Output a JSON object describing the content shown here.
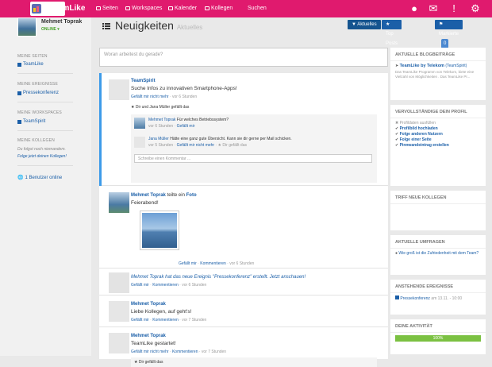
{
  "app": {
    "name": "TeamLike"
  },
  "nav": {
    "items": [
      {
        "label": "Seiten",
        "icon": "pages-icon"
      },
      {
        "label": "Workspaces",
        "icon": "workspaces-icon"
      },
      {
        "label": "Kalender",
        "icon": "calendar-icon"
      },
      {
        "label": "Kollegen",
        "icon": "colleagues-icon"
      }
    ],
    "search_placeholder": "Suchen"
  },
  "colors": {
    "brand": "#e01a6e",
    "accent": "#1b5fa8",
    "success": "#7bc142"
  },
  "user": {
    "name": "Mehmet Toprak",
    "status": "ONLINE"
  },
  "sidebar": {
    "pages_title": "MEINE SEITEN",
    "pages": [
      "TeamLike"
    ],
    "events_title": "MEINE EREIGNISSE",
    "events": [
      "Pressekonferenz"
    ],
    "workspaces_title": "MEINE WORKSPACES",
    "workspaces": [
      "TeamSpirit"
    ],
    "colleagues_title": "MEINE KOLLEGEN",
    "colleagues_empty": "Du folgst noch niemandem.",
    "colleagues_link": "Folge jetzt deinen Kollegen!",
    "online": "1 Benutzer online"
  },
  "page": {
    "title": "Neuigkeiten",
    "subtitle": "Aktuelles",
    "btn_latest": "Aktuelles",
    "btn_top": "Top Posts",
    "btn_marked": "Markierte",
    "marked_count": "0"
  },
  "composer": {
    "placeholder": "Woran arbeitest du gerade?"
  },
  "posts": [
    {
      "author": "TeamSpirit",
      "text": "Suche Infos zu innovativen Smartphone-Apps!",
      "meta_like": "Gefällt mir nicht mehr",
      "meta_time": "· vor 6 Stunden",
      "likes": "Dir und Jana Müller gefällt das",
      "comments": [
        {
          "author": "Mehmet Toprak",
          "text": "Für welches Betriebssystem?",
          "time": "vor 6 Stunden ·",
          "like": "Gefällt mir"
        },
        {
          "author": "Jana Müller",
          "text": "Hätte eine ganz gute Übersicht. Kann sie dir gerne per Mail schicken.",
          "time": "vor 5 Stunden ·",
          "like": "Gefällt mir nicht mehr",
          "extra": "Dir gefällt das"
        }
      ],
      "comment_placeholder": "Schreibe einen Kommentar ..."
    },
    {
      "author": "Mehmet Toprak",
      "action": "teilte ein",
      "object": "Foto",
      "text": "Feierabend!",
      "meta_like": "Gefällt mir",
      "meta_comment": "Kommentieren",
      "meta_time": "· vor 6 Stunden"
    },
    {
      "text": "Mehmet Toprak hat das neue Ereignis \"Pressekonferenz\" erstellt. Jetzt anschauen!",
      "meta_like": "Gefällt mir",
      "meta_comment": "Kommentieren",
      "meta_time": "· vor 6 Stunden"
    },
    {
      "author": "Mehmet Toprak",
      "text": "Liebe Kollegen, auf geht's!",
      "meta_like": "Gefällt mir",
      "meta_comment": "Kommentieren",
      "meta_time": "· vor 7 Stunden"
    },
    {
      "author": "Mehmet Toprak",
      "text": "TeamLike gestartet!",
      "meta_like": "Gefällt mir nicht mehr",
      "meta_comment": "Kommentieren",
      "meta_time": "· vor 7 Stunden",
      "likes": "Dir gefällt das"
    }
  ],
  "right": {
    "blog_title": "AKTUELLE BLOGBEITRÄGE",
    "blog_link": "TeamLike by Telekom",
    "blog_source": "(TeamSpirit)",
    "blog_text": "Das TeamLike Programm von Telekom, biete eine Vielzahl von Möglichkeiten . Das TeamLike Pr...",
    "profile_title": "VERVOLLSTÄNDIGE DEIN PROFIL",
    "profile_items": [
      "Profildaten ausfüllen",
      "Profilbild hochladen",
      "Folge anderen Nutzern",
      "Folge einer Seite",
      "Pinnwandeintrag erstellen"
    ],
    "colleagues_title": "TRIFF NEUE KOLLEGEN",
    "polls_title": "AKTUELLE UMFRAGEN",
    "poll": "Wie groß ist die Zufriedenheit mit dem Team?",
    "events_title": "ANSTEHENDE EREIGNISSE",
    "event": "Pressekonferenz",
    "event_date": "am 13.11. - 10:00",
    "activity_title": "DEINE AKTIVITÄT",
    "activity": "100%",
    "activity_value": 1.0
  }
}
